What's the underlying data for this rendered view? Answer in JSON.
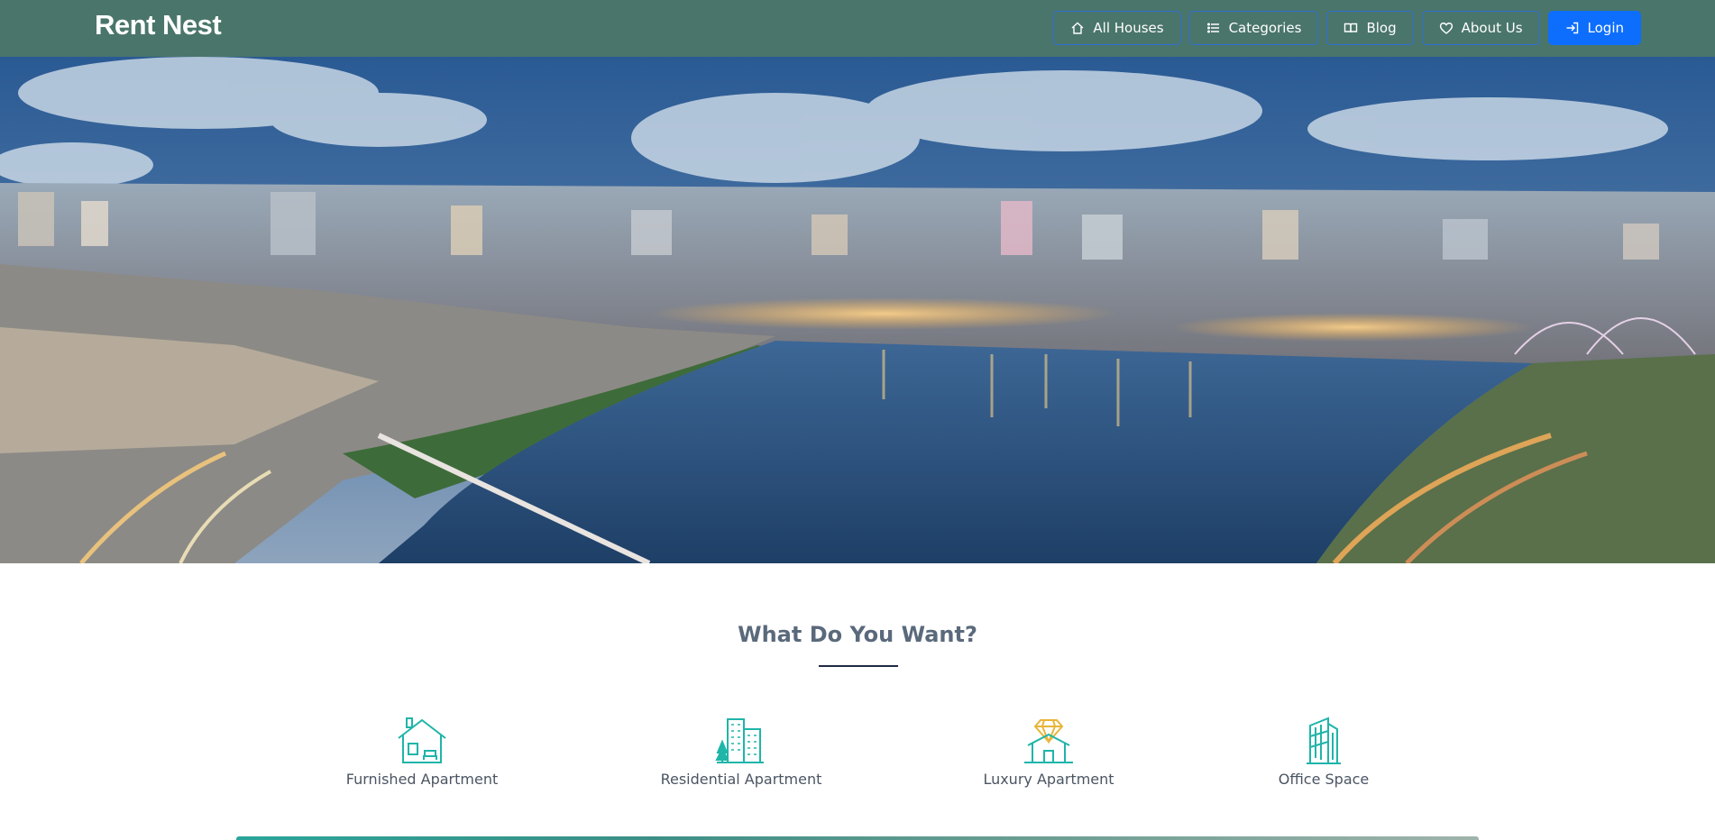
{
  "brand": {
    "name": "Rent Nest"
  },
  "nav": {
    "items": [
      {
        "label": "All Houses",
        "icon": "home-icon"
      },
      {
        "label": "Categories",
        "icon": "list-icon"
      },
      {
        "label": "Blog",
        "icon": "book-icon"
      },
      {
        "label": "About Us",
        "icon": "heart-icon"
      },
      {
        "label": "Login",
        "icon": "login-icon"
      }
    ]
  },
  "colors": {
    "navbar": "#4a756b",
    "primary_button": "#0d6efd",
    "icon_teal": "#1fb5a9",
    "icon_gold": "#e8b53a"
  },
  "categories": {
    "title": "What Do You Want?",
    "items": [
      {
        "label": "Furnished Apartment",
        "icon": "furnished-house-icon"
      },
      {
        "label": "Residential Apartment",
        "icon": "residential-building-icon"
      },
      {
        "label": "Luxury Apartment",
        "icon": "luxury-diamond-house-icon"
      },
      {
        "label": "Office Space",
        "icon": "office-tower-icon"
      }
    ]
  }
}
